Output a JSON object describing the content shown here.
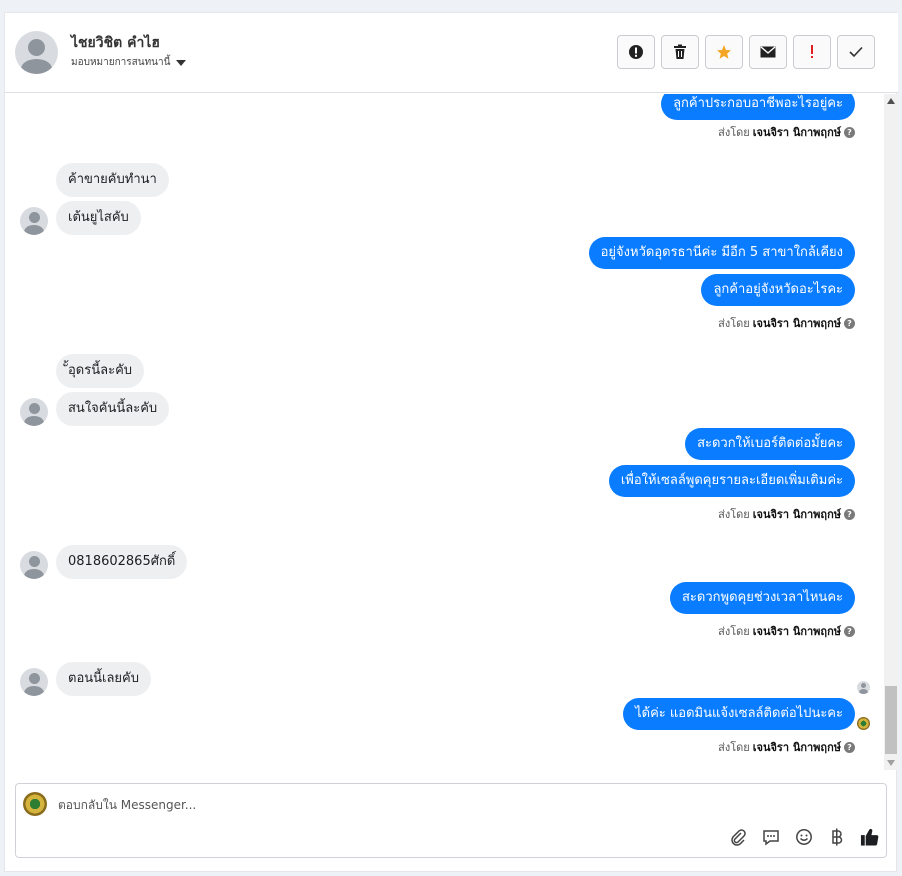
{
  "contact": {
    "name": "ไชยวิชิต คำไฮ",
    "assignment": "มอบหมายการสนทนานี้"
  },
  "header_actions": [
    {
      "name": "alert-icon"
    },
    {
      "name": "trash-icon"
    },
    {
      "name": "star-icon",
      "color": "#f5a524"
    },
    {
      "name": "envelope-icon"
    },
    {
      "name": "exclamation-icon",
      "color": "#e02020"
    },
    {
      "name": "check-icon"
    }
  ],
  "sent_by": {
    "prefix": "ส่งโดย",
    "agent": "เจนจิรา นิกาพฤกษ์",
    "help": "?"
  },
  "messages": [
    {
      "side": "out",
      "text": "ลูกค้าประกอบอาชีพอะไรอยู่คะ"
    },
    {
      "side": "in",
      "text": "ค้าขายคับทำนา"
    },
    {
      "side": "in",
      "text": "เต้นยูไสคับ"
    },
    {
      "side": "out",
      "text": "อยู่จังหวัดอุดรธานีค่ะ มีอีก 5 สาขาใกล้เคียง"
    },
    {
      "side": "out",
      "text": "ลูกค้าอยู่จังหวัดอะไรคะ"
    },
    {
      "side": "in",
      "text": "ั้อุดรนี้ละคับ"
    },
    {
      "side": "in",
      "text": "สนใจคันนี้ละคับ"
    },
    {
      "side": "out",
      "text": "สะดวกให้เบอร์ติดต่อมั้ยคะ"
    },
    {
      "side": "out",
      "text": "เพื่อให้เซลล์พูดคุยรายละเอียดเพิ่มเติมค่ะ"
    },
    {
      "side": "in",
      "text": "0818602865ศักดิ์"
    },
    {
      "side": "out",
      "text": "สะดวกพูดคุยช่วงเวลาไหนคะ"
    },
    {
      "side": "in",
      "text": "ตอนนี้เลยคับ"
    },
    {
      "side": "out",
      "text": "ได้ค่ะ แอดมินแจ้งเซลล์ติดต่อไปนะคะ"
    }
  ],
  "composer": {
    "placeholder": "ตอบกลับใน Messenger...",
    "tools": [
      "paperclip-icon",
      "comment-icon",
      "smiley-icon",
      "baht-icon",
      "thumbs-up-icon"
    ]
  },
  "colors": {
    "outgoing_bubble": "#0a7cff",
    "incoming_bubble": "#eeeff1"
  }
}
